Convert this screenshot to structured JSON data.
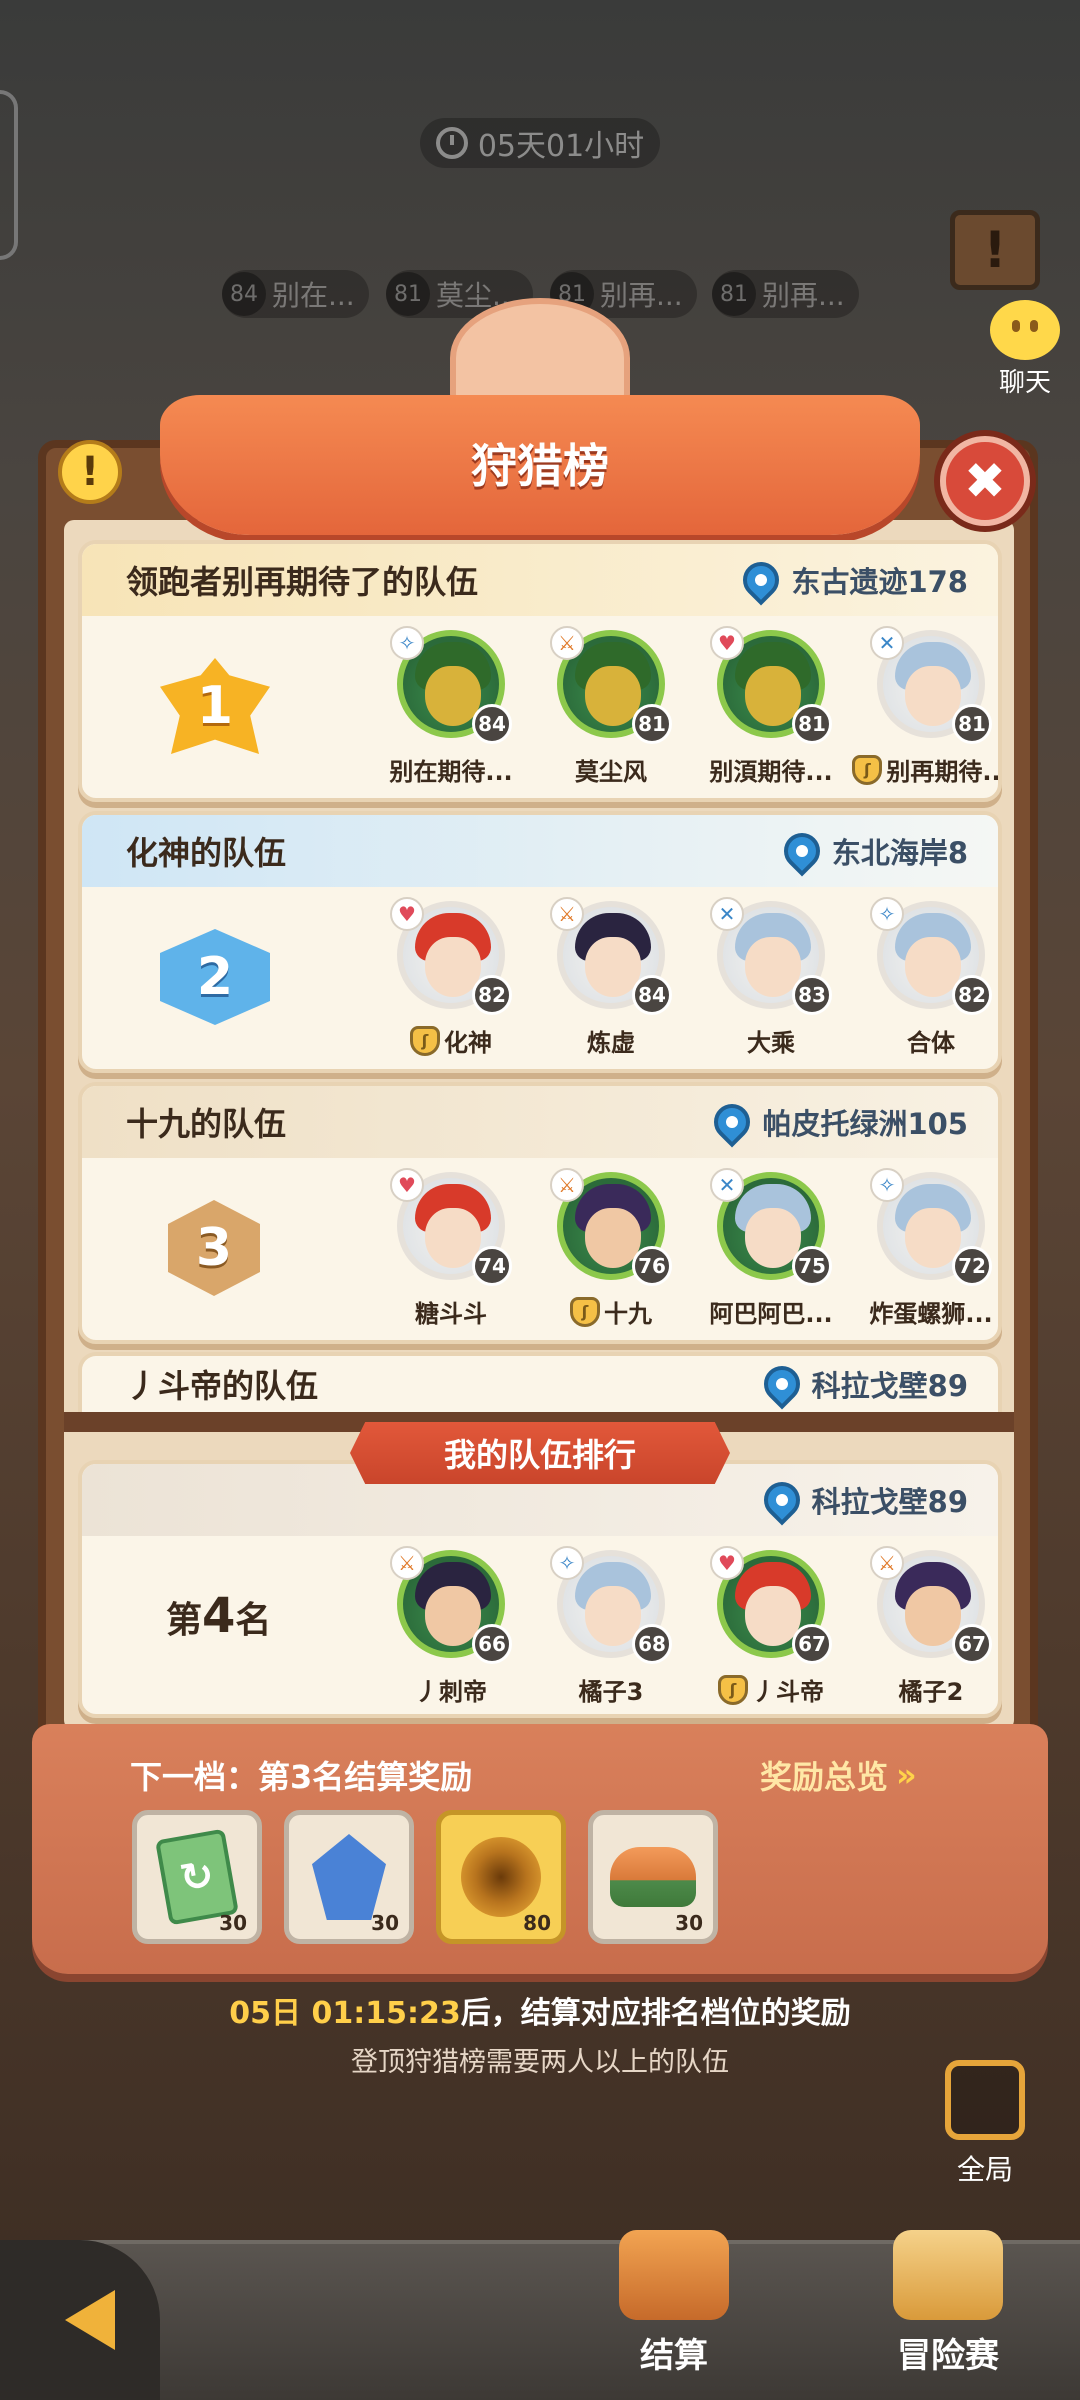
{
  "hud": {
    "countdown": "05天01小时",
    "bg_players": [
      {
        "level": "84",
        "name": "别在..."
      },
      {
        "level": "81",
        "name": "莫尘..."
      },
      {
        "level": "81",
        "name": "别再..."
      },
      {
        "level": "81",
        "name": "别再..."
      }
    ],
    "chat_label": "聊天"
  },
  "header": {
    "title": "狩猎榜",
    "alert_glyph": "!",
    "close_glyph": "✖"
  },
  "teams": [
    {
      "rank": "1",
      "name": "领跑者别再期待了的队伍",
      "location": "东古遗迹178",
      "members": [
        {
          "level": "84",
          "name": "别在期待...",
          "leader": false,
          "role": "mage",
          "role_glyph": "✧"
        },
        {
          "level": "81",
          "name": "莫尘风",
          "leader": false,
          "role": "warrior",
          "role_glyph": "⚔"
        },
        {
          "level": "81",
          "name": "别湏期待...",
          "leader": false,
          "role": "healer",
          "role_glyph": "♥"
        },
        {
          "level": "81",
          "name": "别再期待...",
          "leader": true,
          "role": "archer",
          "role_glyph": "✕"
        }
      ]
    },
    {
      "rank": "2",
      "name": "化神的队伍",
      "location": "东北海岸8",
      "members": [
        {
          "level": "82",
          "name": "化神",
          "leader": true,
          "role": "healer",
          "role_glyph": "♥"
        },
        {
          "level": "84",
          "name": "炼虚",
          "leader": false,
          "role": "warrior",
          "role_glyph": "⚔"
        },
        {
          "level": "83",
          "name": "大乘",
          "leader": false,
          "role": "archer",
          "role_glyph": "✕"
        },
        {
          "level": "82",
          "name": "合体",
          "leader": false,
          "role": "mage",
          "role_glyph": "✧"
        }
      ]
    },
    {
      "rank": "3",
      "name": "十九的队伍",
      "location": "帕皮托绿洲105",
      "members": [
        {
          "level": "74",
          "name": "糖斗斗",
          "leader": false,
          "role": "healer",
          "role_glyph": "♥"
        },
        {
          "level": "76",
          "name": "十九",
          "leader": true,
          "role": "warrior",
          "role_glyph": "⚔"
        },
        {
          "level": "75",
          "name": "阿巴阿巴...",
          "leader": false,
          "role": "archer",
          "role_glyph": "✕"
        },
        {
          "level": "72",
          "name": "炸蛋螺狮...",
          "leader": false,
          "role": "mage",
          "role_glyph": "✧"
        }
      ]
    }
  ],
  "fourth_team": {
    "name": "丿斗帝的队伍",
    "location": "科拉戈壁89"
  },
  "my_team": {
    "banner": "我的队伍排行",
    "location": "科拉戈壁89",
    "rank_prefix": "第",
    "rank_number": "4",
    "rank_suffix": "名",
    "members": [
      {
        "level": "66",
        "name": "丿刺帝",
        "leader": false,
        "role": "warrior",
        "role_glyph": "⚔"
      },
      {
        "level": "68",
        "name": "橘子3",
        "leader": false,
        "role": "mage",
        "role_glyph": "✧"
      },
      {
        "level": "67",
        "name": "丿斗帝",
        "leader": true,
        "role": "healer",
        "role_glyph": "♥"
      },
      {
        "level": "67",
        "name": "橘子2",
        "leader": false,
        "role": "warrior",
        "role_glyph": "⚔"
      }
    ]
  },
  "rewards": {
    "title": "下一档：第3名结算奖励",
    "overview": "奖励总览",
    "overview_chevron": "»",
    "items": [
      {
        "icon": "ticket-icon",
        "count": "30"
      },
      {
        "icon": "crystal-icon",
        "count": "30"
      },
      {
        "icon": "eye-orb-icon",
        "count": "80"
      },
      {
        "icon": "food-plate-icon",
        "count": "30"
      }
    ]
  },
  "settlement": {
    "time": "05日 01:15:23",
    "text": "后，结算对应排名档位的奖励",
    "note": "登顶狩猎榜需要两人以上的队伍"
  },
  "nav": {
    "global": "全局",
    "settle": "结算",
    "adventure": "冒险赛"
  },
  "colors": {
    "accent_orange": "#e4663b",
    "gold": "#f7b324",
    "panel_cream": "#fbf5e8",
    "location_blue": "#2f8fd6"
  }
}
